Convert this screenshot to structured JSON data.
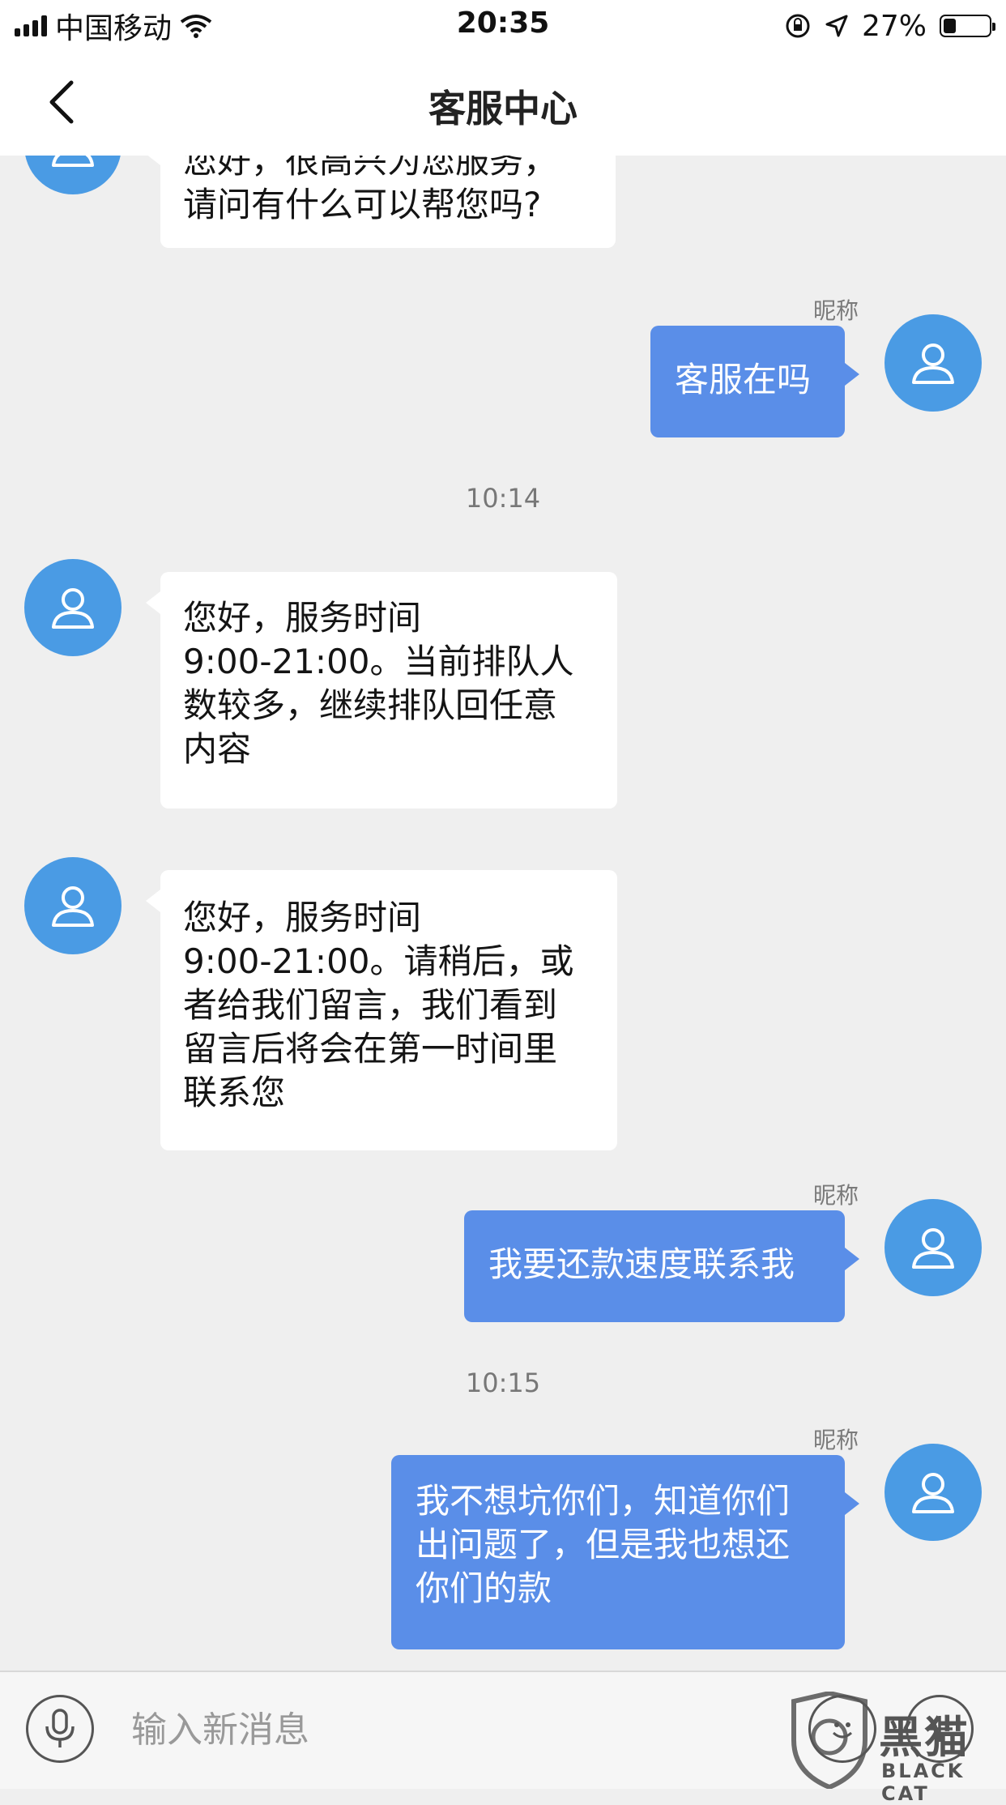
{
  "status_bar": {
    "carrier": "中国移动",
    "time": "20:35",
    "battery_percent": "27%",
    "battery_level": 0.27
  },
  "header": {
    "title": "客服中心"
  },
  "messages": [
    {
      "side": "in",
      "text": "您好，很高兴为您服务，\n请问有什么可以帮您吗?"
    },
    {
      "side": "out",
      "nickname": "昵称",
      "text": "客服在吗"
    },
    {
      "timestamp": "10:14"
    },
    {
      "side": "in",
      "text": "您好，服务时间\n9:00-21:00。当前排队人\n数较多，继续排队回任意\n内容"
    },
    {
      "side": "in",
      "text": "您好，服务时间\n9:00-21:00。请稍后，或\n者给我们留言，我们看到\n留言后将会在第一时间里\n联系您"
    },
    {
      "side": "out",
      "nickname": "昵称",
      "text": "我要还款速度联系我"
    },
    {
      "timestamp": "10:15"
    },
    {
      "side": "out",
      "nickname": "昵称",
      "text": "我不想坑你们，知道你们\n出问题了，但是我也想还\n你们的款"
    }
  ],
  "input_bar": {
    "placeholder": "输入新消息"
  },
  "watermark": {
    "text": "黑猫",
    "subtext": "BLACK CAT"
  },
  "colors": {
    "avatar": "#4a9be4",
    "outgoing_bubble": "#5a8ee8",
    "incoming_bubble": "#ffffff",
    "background": "#efefef"
  },
  "icons": [
    "back-arrow-icon",
    "wifi-icon",
    "signal-icon",
    "orientation-lock-icon",
    "location-icon",
    "battery-icon",
    "user-avatar-icon",
    "microphone-icon",
    "emoji-icon",
    "plus-icon"
  ]
}
